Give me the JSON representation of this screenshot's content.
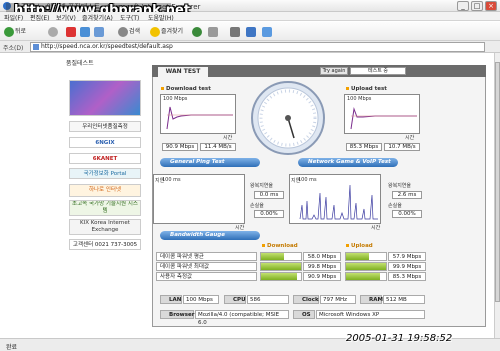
{
  "window": {
    "title": "Microsoft Internet Explorer",
    "title_prefix": "한국정보 · 인터넷 품질테스트 -",
    "watermark": "http://www.gbprank.net"
  },
  "menu": [
    "파일(F)",
    "편집(E)",
    "보기(V)",
    "즐겨찾기(A)",
    "도구(T)",
    "도움말(H)"
  ],
  "toolbar": {
    "back": "뒤로",
    "search": "검색",
    "favorites": "즐겨찾기"
  },
  "address": {
    "label": "주소(D)",
    "url": "http://speed.nca.or.kr/speedtest/default.asp"
  },
  "sidebar": {
    "heading": "품질테스트",
    "items": [
      "우리인터넷품질측정",
      "6NGIX",
      "6KANET",
      "국가정보화 Portal",
      "하나로 인터넷",
      "초고속 국가망 기술지원 시스템",
      "KIX Korea Internet Exchange",
      "고객센터 0021 737-3005"
    ]
  },
  "panel": {
    "tab": "WAN TEST",
    "try_again": "Try again",
    "test_label": "테스트 중"
  },
  "download": {
    "title": "Download test",
    "ymax": "100 Mbps",
    "xlabel": "시간",
    "value1": "90.9 Mbps",
    "value2": "11.4 MB/s"
  },
  "upload": {
    "title": "Upload test",
    "ymax": "100 Mbps",
    "xlabel": "시간",
    "value1": "85.3 Mbps",
    "value2": "10.7 MB/s"
  },
  "ping": {
    "header": "General Ping Test",
    "ylabel": "지연",
    "ymax": "100 ms",
    "xlabel": "시간",
    "rtt_label": "왕복지연율",
    "rtt": "0.0 ms",
    "loss_label": "손실율",
    "loss": "0.00%"
  },
  "game": {
    "header": "Network Game & VoIP Test",
    "ylabel": "지연",
    "ymax": "100 ms",
    "xlabel": "시간",
    "rtt_label": "왕복지연율",
    "rtt": "2.6 ms",
    "loss_label": "손실율",
    "loss": "0.00%"
  },
  "bandwidth": {
    "header": "Bandwidth Gauge",
    "download_label": "Download",
    "upload_label": "Upload",
    "rows": [
      {
        "label": "데이콤 파워넷 평균",
        "down": "58.0 Mbps",
        "down_frac": 0.58,
        "up": "57.9 Mbps",
        "up_frac": 0.579
      },
      {
        "label": "데이콤 파워넷 최대값",
        "down": "99.8 Mbps",
        "down_frac": 0.998,
        "up": "99.9 Mbps",
        "up_frac": 0.999
      },
      {
        "label": "사용자 측정값",
        "down": "90.9 Mbps",
        "down_frac": 0.909,
        "up": "85.3 Mbps",
        "up_frac": 0.853
      }
    ]
  },
  "sysinfo": {
    "lan_label": "LAN",
    "lan": "100 Mbps",
    "cpu_label": "CPU",
    "cpu": "586",
    "clock_label": "Clock",
    "clock": "797 MHz",
    "ram_label": "RAM",
    "ram": "512 MB",
    "browser_label": "Browser",
    "browser": "Mozilla/4.0 (compatible; MSIE 6.0",
    "os_label": "OS",
    "os": "Microsoft Windows XP"
  },
  "status": {
    "text": "완료",
    "datetime": "2005-01-31 19:58:52"
  },
  "colors": {
    "accent": "#2f6fb8",
    "bar": "#7fb021",
    "graph_line": "#7a2c8c",
    "frame": "#6b6b6b"
  }
}
